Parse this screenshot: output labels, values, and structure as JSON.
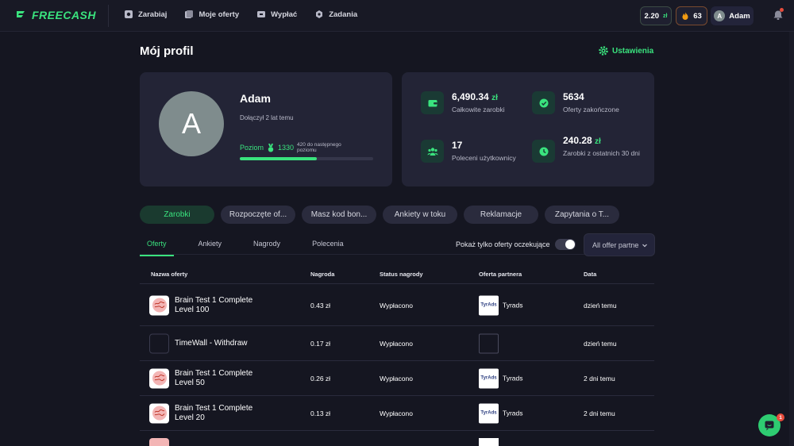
{
  "app": {
    "logo_text": "FREECASH",
    "accent": "#3ae37e"
  },
  "nav": {
    "items": [
      {
        "label": "Zarabiaj",
        "icon": "earn-icon"
      },
      {
        "label": "Moje oferty",
        "icon": "offers-icon"
      },
      {
        "label": "Wypłać",
        "icon": "wallet-icon"
      },
      {
        "label": "Zadania",
        "icon": "tasks-icon"
      }
    ],
    "balance": "2.20",
    "balance_currency": "zł",
    "streak": "63",
    "user_initial": "A",
    "user_name": "Adam"
  },
  "page": {
    "title": "Mój profil",
    "settings_label": "Ustawienia"
  },
  "profile": {
    "initial": "A",
    "name": "Adam",
    "joined": "Dołączył 2 lat temu",
    "level_label": "Poziom",
    "level_value": "1330",
    "next_level": "420 do następnego poziomu",
    "progress_fraction": 0.58
  },
  "stats": [
    {
      "value": "6,490.34",
      "currency": "zł",
      "label": "Całkowite zarobki",
      "icon": "wallet-icon"
    },
    {
      "value": "5634",
      "currency": "",
      "label": "Oferty zakończone",
      "icon": "check-badge-icon"
    },
    {
      "value": "17",
      "currency": "",
      "label": "Poleceni użytkownicy",
      "icon": "users-icon"
    },
    {
      "value": "240.28",
      "currency": "zł",
      "label": "Zarobki z ostatnich 30 dni",
      "icon": "clock-icon"
    }
  ],
  "tabs": [
    "Zarobki",
    "Rozpoczęte of...",
    "Masz kod bon...",
    "Ankiety w toku",
    "Reklamacje",
    "Zapytania o T..."
  ],
  "subtabs": [
    "Oferty",
    "Ankiety",
    "Nagrody",
    "Polecenia"
  ],
  "filters": {
    "pending_label": "Pokaż tylko oferty oczekujące",
    "partner_select": "All offer partne"
  },
  "table": {
    "headers": [
      "Nazwa oferty",
      "Nagroda",
      "Status nagrody",
      "Oferta partnera",
      "Data"
    ],
    "rows": [
      {
        "name": "Brain Test 1 Complete Level 100",
        "reward": "0.43 zł",
        "status": "Wypłacono",
        "partner": "Tyrads",
        "partner_logo": "TyrAds",
        "date": "dzień temu",
        "thumb": "brain-test-icon"
      },
      {
        "name": "TimeWall - Withdraw",
        "reward": "0.17 zł",
        "status": "Wypłacono",
        "partner": "",
        "partner_logo": "",
        "date": "dzień temu",
        "thumb": "timewall-icon"
      },
      {
        "name": "Brain Test 1 Complete Level 50",
        "reward": "0.26 zł",
        "status": "Wypłacono",
        "partner": "Tyrads",
        "partner_logo": "TyrAds",
        "date": "2 dni temu",
        "thumb": "brain-test-icon"
      },
      {
        "name": "Brain Test 1 Complete Level 20",
        "reward": "0.13 zł",
        "status": "Wypłacono",
        "partner": "Tyrads",
        "partner_logo": "TyrAds",
        "date": "2 dni temu",
        "thumb": "brain-test-icon"
      }
    ]
  },
  "chat": {
    "badge": "1"
  }
}
